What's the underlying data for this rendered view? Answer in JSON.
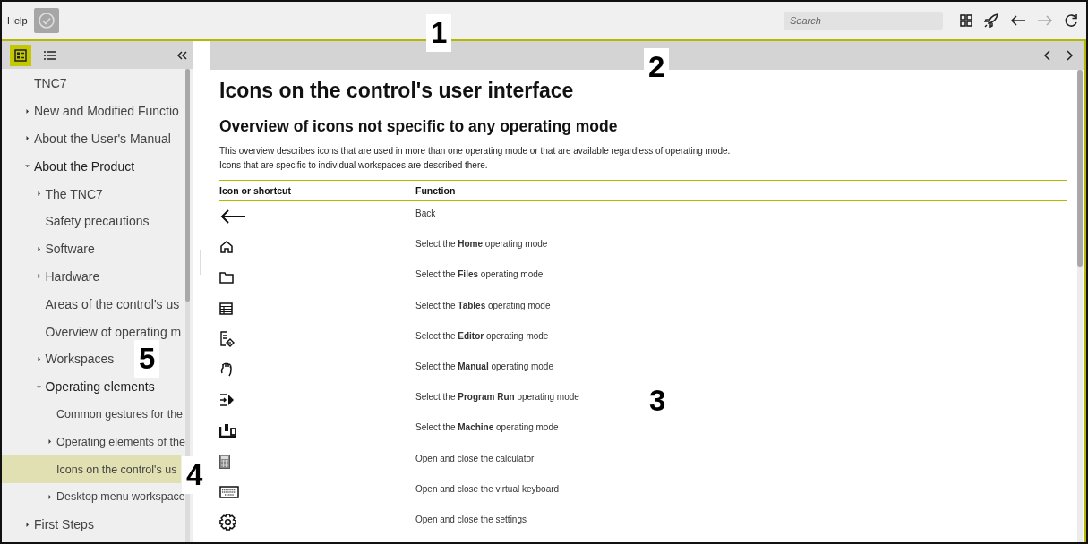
{
  "topbar": {
    "title": "Help",
    "search": {
      "placeholder": "Search"
    },
    "nav": [
      {
        "kind": "back",
        "disabled": false
      },
      {
        "kind": "forward",
        "disabled": true
      }
    ]
  },
  "sidebar": {
    "tabs": [
      {
        "selected": true
      },
      {
        "selected": false
      }
    ],
    "items": [
      {
        "label": "TNC7",
        "selected": false
      },
      {
        "label": "New and Modified Functio",
        "expanded": false,
        "selected": false
      },
      {
        "label": "About the User's Manual",
        "expanded": false,
        "selected": false
      },
      {
        "label": "About the Product",
        "expanded": true,
        "selected": false,
        "children": [
          {
            "label": "The TNC7",
            "expanded": false,
            "selected": false
          },
          {
            "label": "Safety precautions",
            "selected": false
          },
          {
            "label": "Software",
            "expanded": false,
            "selected": false
          },
          {
            "label": "Hardware",
            "expanded": false,
            "selected": false
          },
          {
            "label": "Areas of the control's us",
            "selected": false
          },
          {
            "label": "Overview of operating m",
            "selected": false
          },
          {
            "label": "Workspaces",
            "expanded": false,
            "selected": false
          },
          {
            "label": "Operating elements",
            "expanded": true,
            "selected": false,
            "children": [
              {
                "label": "Common gestures for the",
                "selected": false
              },
              {
                "label": "Operating elements of the",
                "expanded": false,
                "selected": false
              },
              {
                "label": "Icons on the control's us",
                "selected": true
              },
              {
                "label": "Desktop menu workspace",
                "expanded": false,
                "selected": false
              }
            ]
          }
        ]
      },
      {
        "label": "First Steps",
        "expanded": false,
        "selected": false
      }
    ]
  },
  "content": {
    "title": "Icons on the control's user interface",
    "subtitle": "Overview of icons not specific to any operating mode",
    "intro": [
      "This overview describes icons that are used in more than one operating mode or that are available regardless of operating mode.",
      "Icons that are specific to individual workspaces are described there."
    ],
    "table": {
      "columns": [
        "Icon or shortcut",
        "Function"
      ],
      "rows": [
        {
          "function": "Back"
        },
        {
          "function": "Select the **Home** operating mode"
        },
        {
          "function": "Select the **Files** operating mode"
        },
        {
          "function": "Select the **Tables** operating mode"
        },
        {
          "function": "Select the **Editor** operating mode"
        },
        {
          "function": "Select the **Manual** operating mode"
        },
        {
          "function": "Select the **Program Run** operating mode"
        },
        {
          "function": "Select the **Machine** operating mode"
        },
        {
          "function": "Open and close the calculator"
        },
        {
          "function": "Open and close the virtual keyboard"
        },
        {
          "function": "Open and close the settings"
        }
      ]
    }
  },
  "callouts": [
    "1",
    "2",
    "3",
    "4",
    "5"
  ]
}
